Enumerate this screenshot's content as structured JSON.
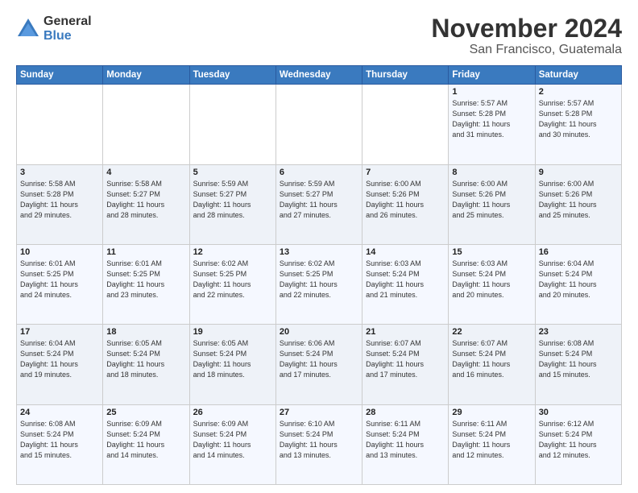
{
  "logo": {
    "general": "General",
    "blue": "Blue"
  },
  "title": "November 2024",
  "location": "San Francisco, Guatemala",
  "days_header": [
    "Sunday",
    "Monday",
    "Tuesday",
    "Wednesday",
    "Thursday",
    "Friday",
    "Saturday"
  ],
  "weeks": [
    [
      {
        "day": "",
        "info": ""
      },
      {
        "day": "",
        "info": ""
      },
      {
        "day": "",
        "info": ""
      },
      {
        "day": "",
        "info": ""
      },
      {
        "day": "",
        "info": ""
      },
      {
        "day": "1",
        "info": "Sunrise: 5:57 AM\nSunset: 5:28 PM\nDaylight: 11 hours\nand 31 minutes."
      },
      {
        "day": "2",
        "info": "Sunrise: 5:57 AM\nSunset: 5:28 PM\nDaylight: 11 hours\nand 30 minutes."
      }
    ],
    [
      {
        "day": "3",
        "info": "Sunrise: 5:58 AM\nSunset: 5:28 PM\nDaylight: 11 hours\nand 29 minutes."
      },
      {
        "day": "4",
        "info": "Sunrise: 5:58 AM\nSunset: 5:27 PM\nDaylight: 11 hours\nand 28 minutes."
      },
      {
        "day": "5",
        "info": "Sunrise: 5:59 AM\nSunset: 5:27 PM\nDaylight: 11 hours\nand 28 minutes."
      },
      {
        "day": "6",
        "info": "Sunrise: 5:59 AM\nSunset: 5:27 PM\nDaylight: 11 hours\nand 27 minutes."
      },
      {
        "day": "7",
        "info": "Sunrise: 6:00 AM\nSunset: 5:26 PM\nDaylight: 11 hours\nand 26 minutes."
      },
      {
        "day": "8",
        "info": "Sunrise: 6:00 AM\nSunset: 5:26 PM\nDaylight: 11 hours\nand 25 minutes."
      },
      {
        "day": "9",
        "info": "Sunrise: 6:00 AM\nSunset: 5:26 PM\nDaylight: 11 hours\nand 25 minutes."
      }
    ],
    [
      {
        "day": "10",
        "info": "Sunrise: 6:01 AM\nSunset: 5:25 PM\nDaylight: 11 hours\nand 24 minutes."
      },
      {
        "day": "11",
        "info": "Sunrise: 6:01 AM\nSunset: 5:25 PM\nDaylight: 11 hours\nand 23 minutes."
      },
      {
        "day": "12",
        "info": "Sunrise: 6:02 AM\nSunset: 5:25 PM\nDaylight: 11 hours\nand 22 minutes."
      },
      {
        "day": "13",
        "info": "Sunrise: 6:02 AM\nSunset: 5:25 PM\nDaylight: 11 hours\nand 22 minutes."
      },
      {
        "day": "14",
        "info": "Sunrise: 6:03 AM\nSunset: 5:24 PM\nDaylight: 11 hours\nand 21 minutes."
      },
      {
        "day": "15",
        "info": "Sunrise: 6:03 AM\nSunset: 5:24 PM\nDaylight: 11 hours\nand 20 minutes."
      },
      {
        "day": "16",
        "info": "Sunrise: 6:04 AM\nSunset: 5:24 PM\nDaylight: 11 hours\nand 20 minutes."
      }
    ],
    [
      {
        "day": "17",
        "info": "Sunrise: 6:04 AM\nSunset: 5:24 PM\nDaylight: 11 hours\nand 19 minutes."
      },
      {
        "day": "18",
        "info": "Sunrise: 6:05 AM\nSunset: 5:24 PM\nDaylight: 11 hours\nand 18 minutes."
      },
      {
        "day": "19",
        "info": "Sunrise: 6:05 AM\nSunset: 5:24 PM\nDaylight: 11 hours\nand 18 minutes."
      },
      {
        "day": "20",
        "info": "Sunrise: 6:06 AM\nSunset: 5:24 PM\nDaylight: 11 hours\nand 17 minutes."
      },
      {
        "day": "21",
        "info": "Sunrise: 6:07 AM\nSunset: 5:24 PM\nDaylight: 11 hours\nand 17 minutes."
      },
      {
        "day": "22",
        "info": "Sunrise: 6:07 AM\nSunset: 5:24 PM\nDaylight: 11 hours\nand 16 minutes."
      },
      {
        "day": "23",
        "info": "Sunrise: 6:08 AM\nSunset: 5:24 PM\nDaylight: 11 hours\nand 15 minutes."
      }
    ],
    [
      {
        "day": "24",
        "info": "Sunrise: 6:08 AM\nSunset: 5:24 PM\nDaylight: 11 hours\nand 15 minutes."
      },
      {
        "day": "25",
        "info": "Sunrise: 6:09 AM\nSunset: 5:24 PM\nDaylight: 11 hours\nand 14 minutes."
      },
      {
        "day": "26",
        "info": "Sunrise: 6:09 AM\nSunset: 5:24 PM\nDaylight: 11 hours\nand 14 minutes."
      },
      {
        "day": "27",
        "info": "Sunrise: 6:10 AM\nSunset: 5:24 PM\nDaylight: 11 hours\nand 13 minutes."
      },
      {
        "day": "28",
        "info": "Sunrise: 6:11 AM\nSunset: 5:24 PM\nDaylight: 11 hours\nand 13 minutes."
      },
      {
        "day": "29",
        "info": "Sunrise: 6:11 AM\nSunset: 5:24 PM\nDaylight: 11 hours\nand 12 minutes."
      },
      {
        "day": "30",
        "info": "Sunrise: 6:12 AM\nSunset: 5:24 PM\nDaylight: 11 hours\nand 12 minutes."
      }
    ]
  ]
}
